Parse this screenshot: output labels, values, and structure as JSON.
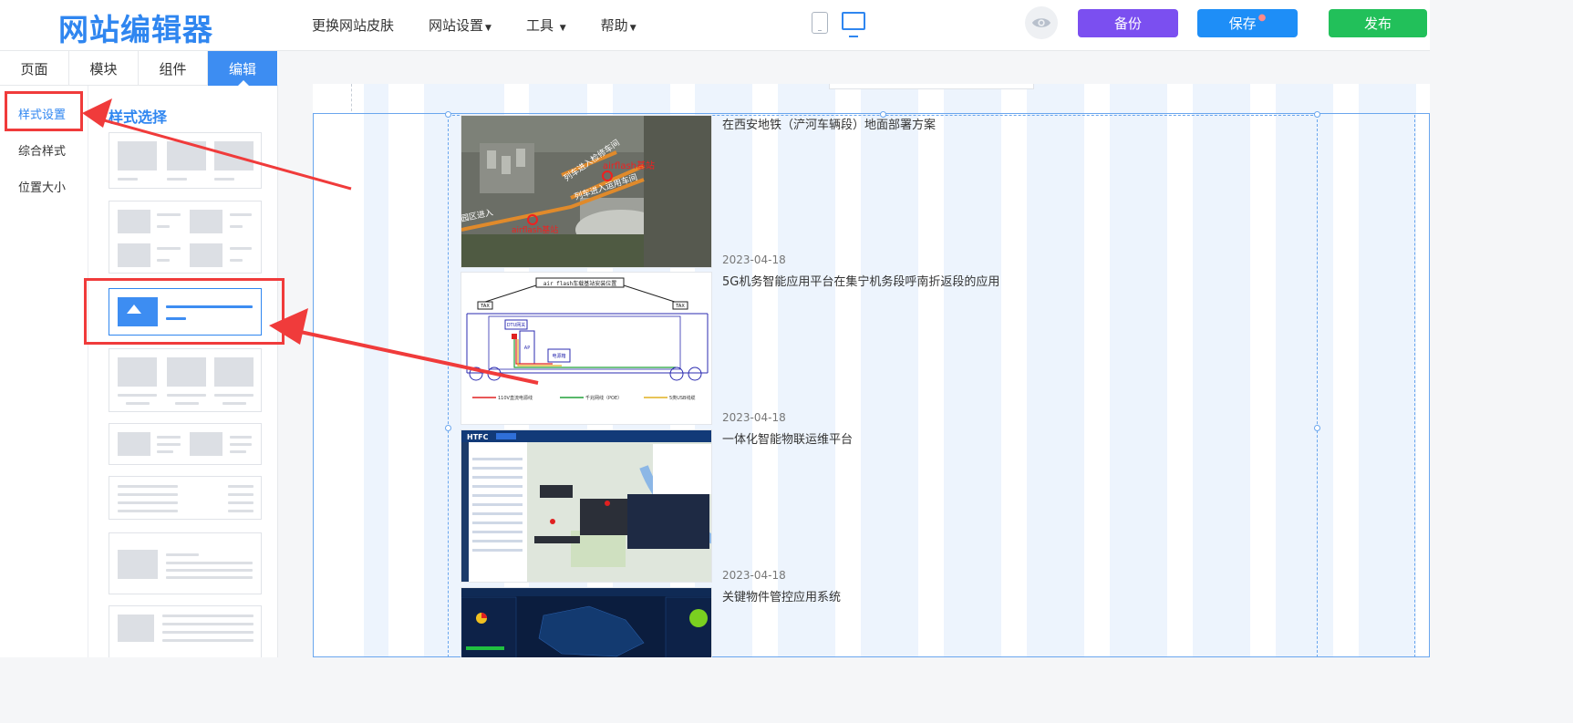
{
  "header": {
    "logo": "网站编辑器",
    "nav": [
      "更换网站皮肤",
      "网站设置",
      "工具",
      "帮助"
    ],
    "buttons": {
      "backup": "备份",
      "save": "保存",
      "publish": "发布"
    }
  },
  "tabs": [
    "页面",
    "模块",
    "组件",
    "编辑"
  ],
  "left_menu": [
    "样式设置",
    "综合样式",
    "位置大小"
  ],
  "style_panel": {
    "title": "样式选择"
  },
  "news": [
    {
      "title": "在西安地铁（浐河车辆段）地面部署方案",
      "date": "2023-04-18"
    },
    {
      "title": "5G机务智能应用平台在集宁机务段呼南折返段的应用",
      "date": "2023-04-18"
    },
    {
      "title": "一体化智能物联运维平台",
      "date": "2023-04-18"
    },
    {
      "title": "关键物件管控应用系统",
      "date": ""
    }
  ],
  "thumb_text": {
    "aerial_1": "airflash基站",
    "aerial_2": "列车进入运用车间",
    "aerial_3": "园区进入",
    "aerial_4": "airflash基站",
    "aerial_5": "列车进入检修车间",
    "diagram_title": "air flash车载基站安装位置",
    "diagram_tax_left": "TAX",
    "diagram_tax_right": "TAX",
    "diagram_gateway": "DTU网关",
    "diagram_box": "电源箱",
    "diagram_legend_1": "110V直流电源线",
    "diagram_legend_2": "千兆网线（POE）",
    "diagram_legend_3": "5类USB线缆",
    "diagram_ap": "AP",
    "app_brand": "HTFC"
  },
  "colors": {
    "accent": "#2f86f0",
    "backup": "#7b4ff0",
    "save": "#1e8ef7",
    "publish": "#22c05a",
    "annotation": "#f03b3b"
  },
  "icons": [
    "mobile-device-icon",
    "desktop-device-icon",
    "eye-icon"
  ]
}
